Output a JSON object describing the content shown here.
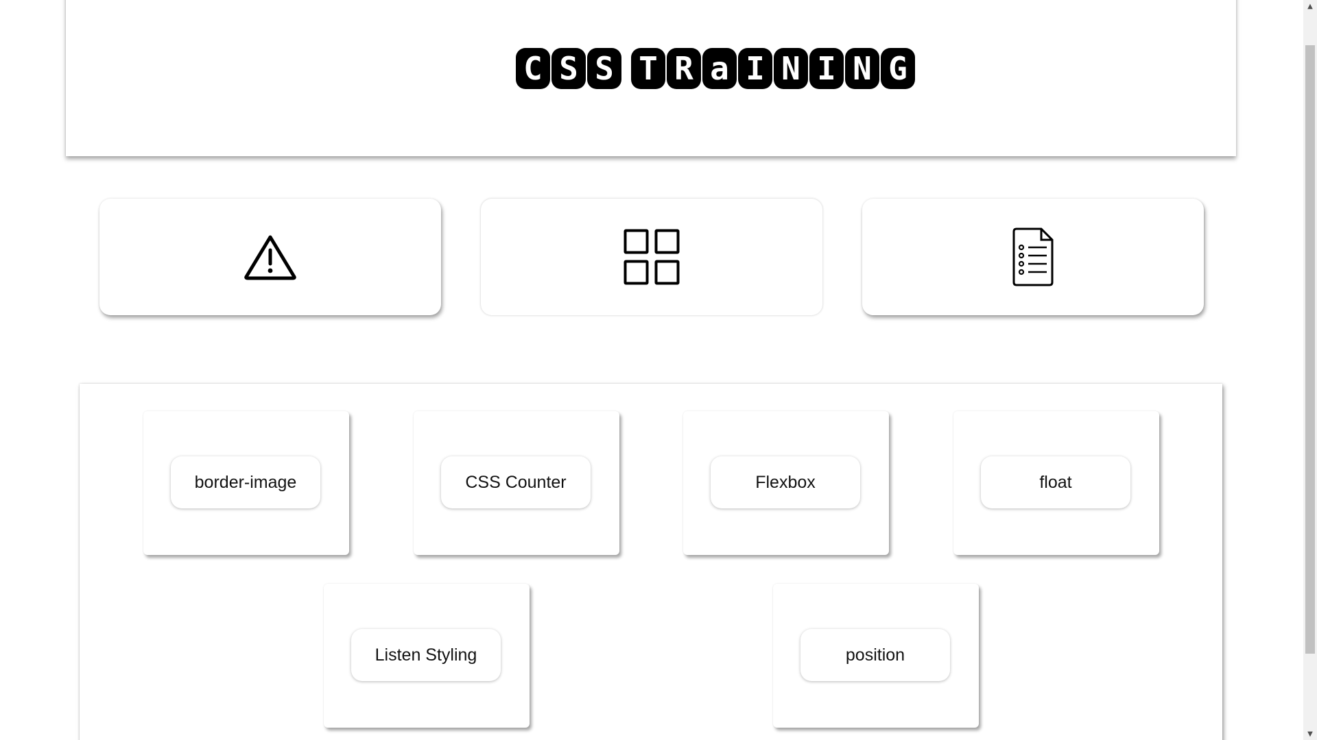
{
  "header": {
    "logo_words": [
      [
        "C",
        "S",
        "S"
      ],
      [
        "T",
        "R",
        "a",
        "I",
        "N",
        "I",
        "N",
        "G"
      ]
    ]
  },
  "icon_cards": [
    {
      "icon": "warning-triangle-icon"
    },
    {
      "icon": "grid-four-squares-icon"
    },
    {
      "icon": "document-list-icon"
    }
  ],
  "topics": [
    {
      "label": "border-image"
    },
    {
      "label": "CSS Counter"
    },
    {
      "label": "Flexbox"
    },
    {
      "label": "float"
    },
    {
      "label": "Listen Styling"
    },
    {
      "label": "position"
    }
  ],
  "scrollbar": {
    "up_arrow": "▲",
    "down_arrow": "▼"
  },
  "colors": {
    "logo_tile": "#000000",
    "logo_text": "#ffffff",
    "background": "#ffffff"
  }
}
